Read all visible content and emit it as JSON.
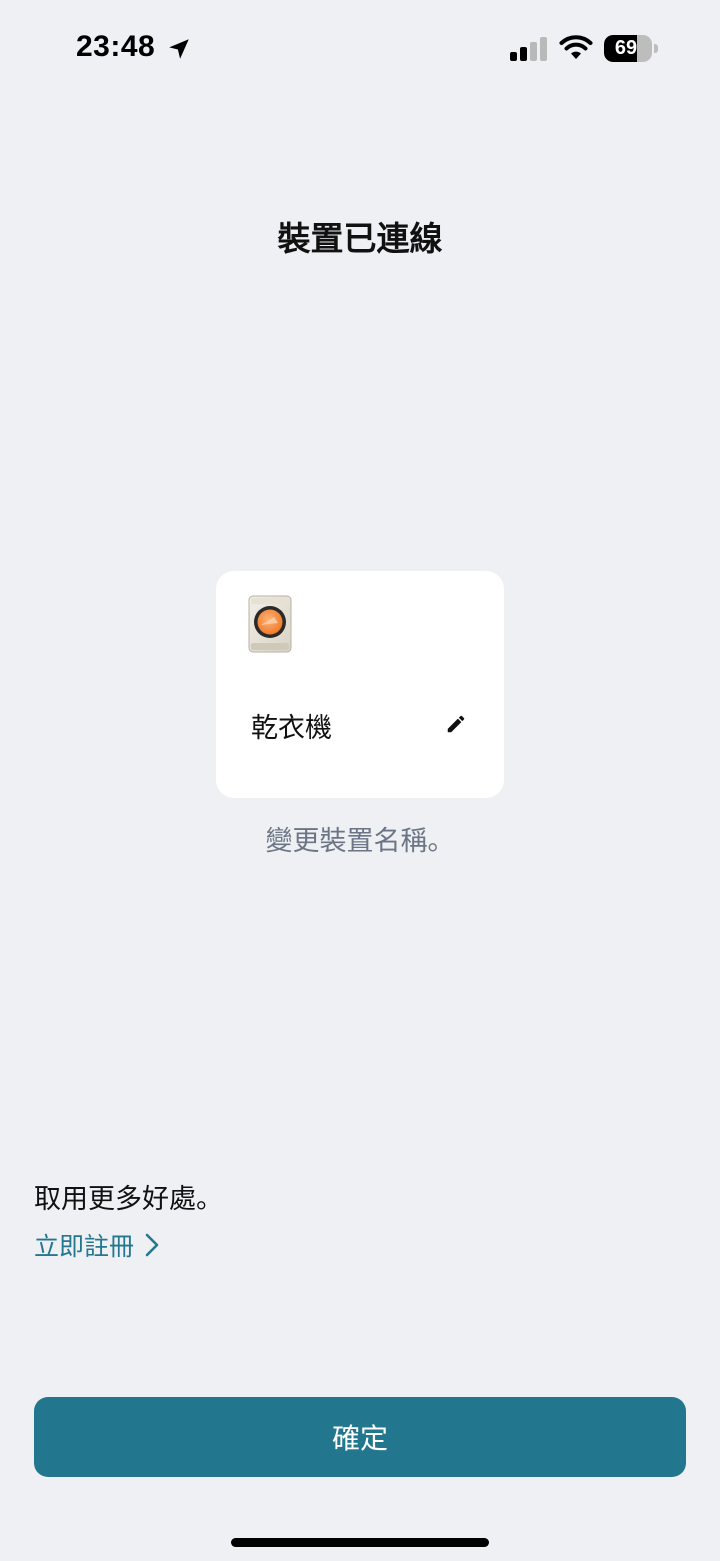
{
  "status_bar": {
    "time": "23:48",
    "battery_level": "69",
    "icons": [
      "location-arrow-icon",
      "cellular-signal-icon",
      "wifi-icon",
      "battery-icon"
    ]
  },
  "page": {
    "title": "裝置已連線"
  },
  "device_card": {
    "icon": "clothes-dryer-icon",
    "name": "乾衣機",
    "edit_icon": "pencil-icon",
    "rename_hint": "變更裝置名稱。"
  },
  "signup": {
    "benefits_text": "取用更多好處。",
    "register_label": "立即註冊",
    "link_color": "#23788f"
  },
  "footer": {
    "confirm_label": "確定",
    "button_color": "#22778e"
  },
  "colors": {
    "background": "#eff0f4",
    "card": "#ffffff",
    "hint_text": "#6b7585"
  }
}
